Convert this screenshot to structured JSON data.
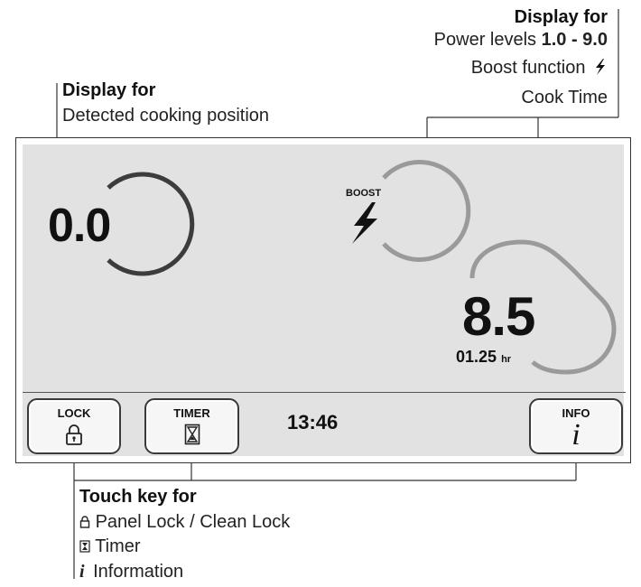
{
  "annotations": {
    "cooking_position": {
      "heading": "Display for",
      "line": "Detected cooking position"
    },
    "power": {
      "heading": "Display for",
      "line1_prefix": "Power levels ",
      "line1_bold": "1.0 - 9.0",
      "line2": "Boost function",
      "line3": "Cook Time"
    },
    "touch_keys": {
      "heading": "Touch key for",
      "items": [
        "Panel Lock / Clean Lock",
        "Timer",
        "Information"
      ]
    }
  },
  "display": {
    "cooking_position_value": "0.0",
    "boost_label": "BOOST",
    "power_level": "8.5",
    "cook_time": "01.25",
    "cook_time_unit": "hr",
    "clock": "13:46"
  },
  "keys": {
    "lock": {
      "label": "LOCK",
      "icon": "padlock-icon"
    },
    "timer": {
      "label": "TIMER",
      "icon": "hourglass-icon"
    },
    "info": {
      "label": "INFO",
      "icon": "info-icon"
    }
  },
  "colors": {
    "dark_ring": "#3c3c3c",
    "light_ring": "#9a9a9a",
    "screen_bg": "#e2e2e2"
  }
}
